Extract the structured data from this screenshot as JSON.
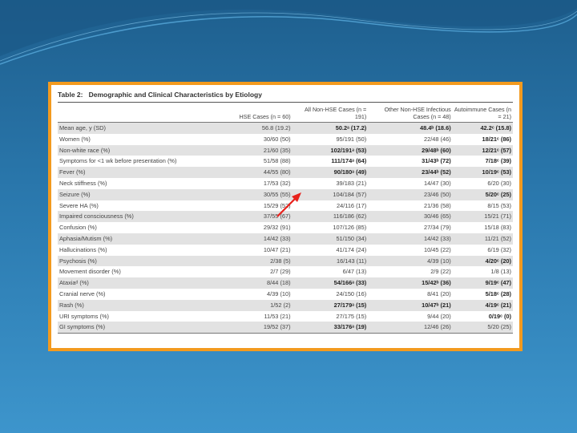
{
  "caption": {
    "label": "Table 2:",
    "title": "Demographic and Clinical Characteristics by Etiology"
  },
  "columns": [
    "",
    "HSE Cases (n = 60)",
    "All Non-HSE Cases (n = 191)",
    "Other Non-HSE Infectious Cases (n = 48)",
    "Autoimmune Cases (n = 21)"
  ],
  "rows": [
    {
      "label": "Mean age, y (SD)",
      "cells": [
        "56.8 (19.2)",
        "50.2ᵃ (17.2)",
        "48.4ᵇ (18.6)",
        "42.2ᶜ (15.8)"
      ],
      "bold": [
        false,
        true,
        true,
        true
      ]
    },
    {
      "label": "Women (%)",
      "cells": [
        "30/60 (50)",
        "95/191 (50)",
        "22/48 (46)",
        "18/21ᶜ (86)"
      ],
      "bold": [
        false,
        false,
        false,
        true
      ]
    },
    {
      "label": "Non-white race (%)",
      "cells": [
        "21/60 (35)",
        "102/191ᵃ (53)",
        "29/48ᵇ (60)",
        "12/21ᶜ (57)"
      ],
      "bold": [
        false,
        true,
        true,
        true
      ]
    },
    {
      "label": "Symptoms for <1 wk before presentation (%)",
      "cells": [
        "51/58 (88)",
        "111/174ᵃ (64)",
        "31/43ᵇ (72)",
        "7/18ᶜ (39)"
      ],
      "bold": [
        false,
        true,
        true,
        true
      ]
    },
    {
      "label": "Fever (%)",
      "cells": [
        "44/55 (80)",
        "90/180ᵃ (49)",
        "23/44ᵇ (52)",
        "10/19ᶜ (53)"
      ],
      "bold": [
        false,
        true,
        true,
        true
      ]
    },
    {
      "label": "Neck stiffness (%)",
      "cells": [
        "17/53 (32)",
        "39/183 (21)",
        "14/47 (30)",
        "6/20 (30)"
      ],
      "bold": [
        false,
        false,
        false,
        false
      ]
    },
    {
      "label": "Seizure (%)",
      "cells": [
        "30/55 (55)",
        "104/184 (57)",
        "23/46 (50)",
        "5/20ᶜ (25)"
      ],
      "bold": [
        false,
        false,
        false,
        true
      ]
    },
    {
      "label": "Severe HA (%)",
      "cells": [
        "15/29 (52)",
        "24/116 (17)",
        "21/36 (58)",
        "8/15 (53)"
      ],
      "bold": [
        false,
        false,
        false,
        false
      ]
    },
    {
      "label": "Impaired consciousness (%)",
      "cells": [
        "37/55 (67)",
        "116/186 (62)",
        "30/46 (65)",
        "15/21 (71)"
      ],
      "bold": [
        false,
        false,
        false,
        false
      ]
    },
    {
      "label": "Confusion (%)",
      "cells": [
        "29/32 (91)",
        "107/126 (85)",
        "27/34 (79)",
        "15/18 (83)"
      ],
      "bold": [
        false,
        false,
        false,
        false
      ]
    },
    {
      "label": "Aphasia/Mutism (%)",
      "cells": [
        "14/42 (33)",
        "51/150 (34)",
        "14/42 (33)",
        "11/21 (52)"
      ],
      "bold": [
        false,
        false,
        false,
        false
      ]
    },
    {
      "label": "Hallucinations (%)",
      "cells": [
        "10/47 (21)",
        "41/174 (24)",
        "10/45 (22)",
        "6/19 (32)"
      ],
      "bold": [
        false,
        false,
        false,
        false
      ]
    },
    {
      "label": "Psychosis (%)",
      "cells": [
        "2/38 (5)",
        "16/143 (11)",
        "4/39 (10)",
        "4/20ᶜ (20)"
      ],
      "bold": [
        false,
        false,
        false,
        true
      ]
    },
    {
      "label": "Movement disorder (%)",
      "cells": [
        "2/7 (29)",
        "6/47 (13)",
        "2/9 (22)",
        "1/8 (13)"
      ],
      "bold": [
        false,
        false,
        false,
        false
      ]
    },
    {
      "label": "Ataxiaᵈ (%)",
      "cells": [
        "8/44 (18)",
        "54/166ᵃ (33)",
        "15/42ᵇ (36)",
        "9/19ᶜ (47)"
      ],
      "bold": [
        false,
        true,
        true,
        true
      ]
    },
    {
      "label": "Cranial nerve (%)",
      "cells": [
        "4/39 (10)",
        "24/150 (16)",
        "8/41 (20)",
        "5/18ᶜ (28)"
      ],
      "bold": [
        false,
        false,
        false,
        true
      ]
    },
    {
      "label": "Rash (%)",
      "cells": [
        "1/52 (2)",
        "27/179ᵃ (15)",
        "10/47ᵇ (21)",
        "4/19ᶜ (21)"
      ],
      "bold": [
        false,
        true,
        true,
        true
      ]
    },
    {
      "label": "URI symptoms (%)",
      "cells": [
        "11/53 (21)",
        "27/175 (15)",
        "9/44 (20)",
        "0/19ᶜ (0)"
      ],
      "bold": [
        false,
        false,
        false,
        true
      ]
    },
    {
      "label": "GI symptoms (%)",
      "cells": [
        "19/52 (37)",
        "33/176ᵃ (19)",
        "12/46 (26)",
        "5/20 (25)"
      ],
      "bold": [
        false,
        true,
        false,
        false
      ]
    }
  ],
  "colors": {
    "frame": "#f39a1e",
    "background": "#2a78ad",
    "stripe": "#e2e2e2",
    "arrow": "#e8221c"
  },
  "icons": {
    "arrow": "red-arrow-icon"
  }
}
